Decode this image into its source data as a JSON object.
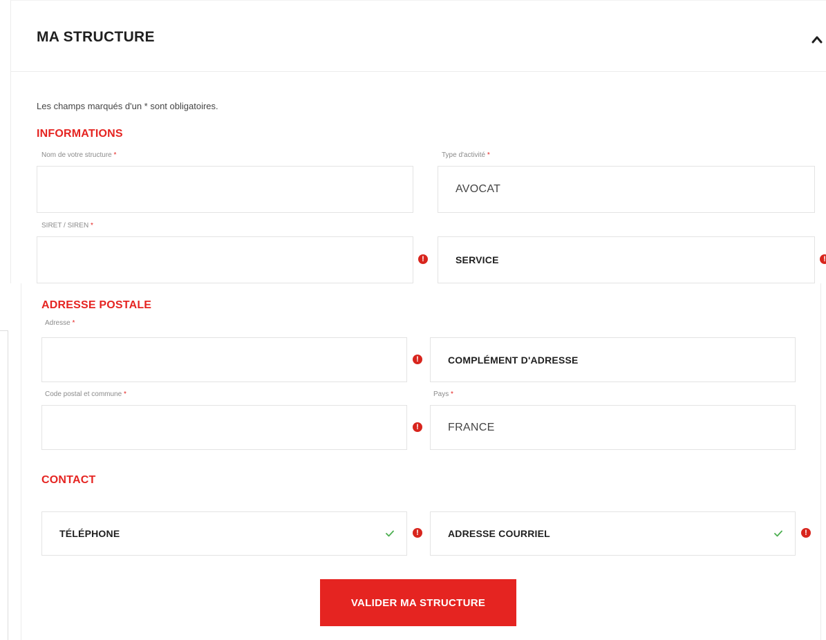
{
  "header": {
    "title": "MA STRUCTURE"
  },
  "hint": "Les champs marqués d'un * sont obligatoires.",
  "informations": {
    "title": "INFORMATIONS",
    "structure_label": "Nom de votre structure",
    "activity_label": "Type d'activité",
    "activity_value": "AVOCAT",
    "siret_label": "SIRET / SIREN",
    "service_placeholder": "SERVICE"
  },
  "postal": {
    "title": "ADRESSE POSTALE",
    "address_label": "Adresse",
    "complement_placeholder": "COMPLÉMENT D'ADRESSE",
    "zip_label": "Code postal et commune",
    "country_label": "Pays",
    "country_value": "FRANCE"
  },
  "contact": {
    "title": "CONTACT",
    "phone_placeholder": "TÉLÉPHONE",
    "email_placeholder": "ADRESSE COURRIEL"
  },
  "required_mark": "*",
  "error_mark": "!",
  "submit_label": "VALIDER MA STRUCTURE",
  "colors": {
    "accent": "#e52421",
    "error": "#d8251d",
    "valid": "#4caf50"
  }
}
